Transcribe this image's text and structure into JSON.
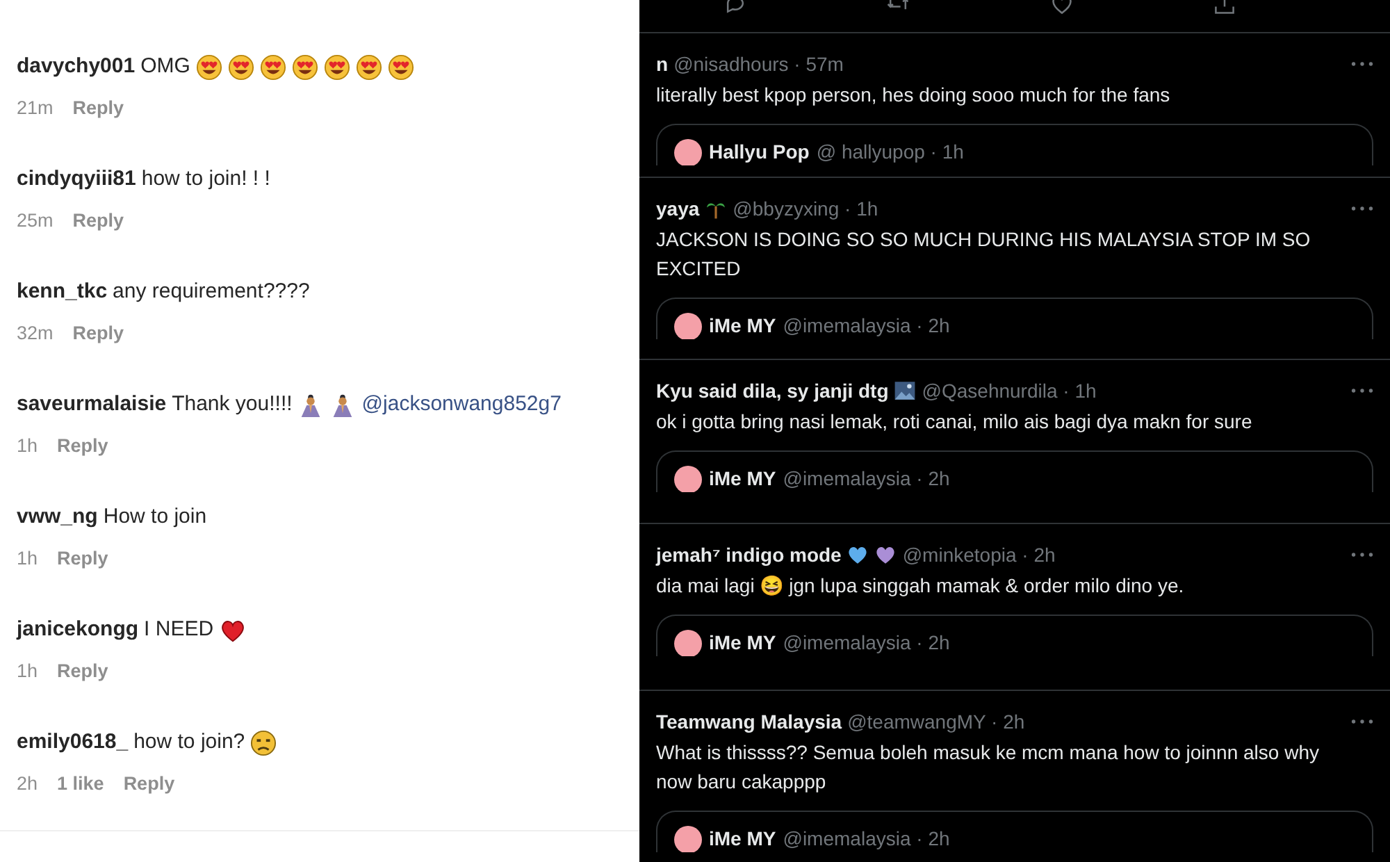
{
  "comments": [
    {
      "user": "davychy001",
      "parts": [
        {
          "kind": "text",
          "text": "OMG"
        },
        {
          "kind": "hearteyes"
        },
        {
          "kind": "hearteyes"
        },
        {
          "kind": "hearteyes"
        },
        {
          "kind": "hearteyes"
        },
        {
          "kind": "hearteyes"
        },
        {
          "kind": "hearteyes"
        },
        {
          "kind": "hearteyes"
        }
      ],
      "time": "21m",
      "reply": "Reply"
    },
    {
      "user": "cindyqyiii81",
      "parts": [
        {
          "kind": "text",
          "text": "how to join!  !  !"
        }
      ],
      "time": "25m",
      "reply": "Reply"
    },
    {
      "user": "kenn_tkc",
      "parts": [
        {
          "kind": "text",
          "text": "any requirement????"
        }
      ],
      "time": "32m",
      "reply": "Reply"
    },
    {
      "user": "saveurmalaisie",
      "parts": [
        {
          "kind": "text",
          "text": "Thank you!!!!"
        },
        {
          "kind": "pray"
        },
        {
          "kind": "pray"
        },
        {
          "kind": "mention",
          "text": "@jacksonwang852g7"
        }
      ],
      "time": "1h",
      "reply": "Reply"
    },
    {
      "user": "vww_ng",
      "parts": [
        {
          "kind": "text",
          "text": "How to join"
        }
      ],
      "time": "1h",
      "reply": "Reply"
    },
    {
      "user": "janicekongg",
      "parts": [
        {
          "kind": "text",
          "text": "I NEED"
        },
        {
          "kind": "heart"
        }
      ],
      "time": "1h",
      "reply": "Reply"
    },
    {
      "user": "emily0618_",
      "parts": [
        {
          "kind": "text",
          "text": "how to join?"
        },
        {
          "kind": "frown"
        }
      ],
      "time": "2h",
      "likes": "1 like",
      "reply": "Reply"
    }
  ],
  "tweets": [
    {
      "name": "n",
      "handle": "@nisadhours · 57m",
      "text": "literally best kpop person, hes doing sooo much for the fans",
      "quote": {
        "name": "Hallyu Pop",
        "handle": "@ hallyupop · 1h"
      }
    },
    {
      "name": "yaya",
      "name_icons": [
        {
          "kind": "palm"
        }
      ],
      "handle": "@bbyzyxing · 1h",
      "text": "JACKSON IS DOING SO SO MUCH DURING HIS MALAYSIA STOP IM SO EXCITED",
      "quote": {
        "name": "iMe MY",
        "handle": "@imemalaysia · 2h"
      }
    },
    {
      "name": "Kyu said dila, sy janji dtg",
      "name_icons": [
        {
          "kind": "picture"
        }
      ],
      "handle": "@Qasehnurdila · 1h",
      "text": "ok i gotta bring nasi lemak, roti canai, milo ais bagi dya makn for sure",
      "quote": {
        "name": "iMe MY",
        "handle": "@imemalaysia · 2h"
      }
    },
    {
      "name": "jemah⁷ indigo mode",
      "name_icons": [
        {
          "kind": "blueheart"
        },
        {
          "kind": "purpleheart"
        }
      ],
      "handle": "@minketopia · 2h",
      "text": "dia mai lagi 😆 jgn lupa singgah mamak & order milo dino ye.",
      "quote": {
        "name": "iMe MY",
        "handle": "@imemalaysia · 2h"
      }
    },
    {
      "name": "Teamwang Malaysia",
      "handle": "@teamwangMY · 2h",
      "text": "What is thissss?? Semua boleh masuk ke mcm mana how to joinnn also why now baru cakapppp",
      "quote": {
        "name": "iMe MY",
        "handle": "@imemalaysia · 2h"
      }
    }
  ]
}
